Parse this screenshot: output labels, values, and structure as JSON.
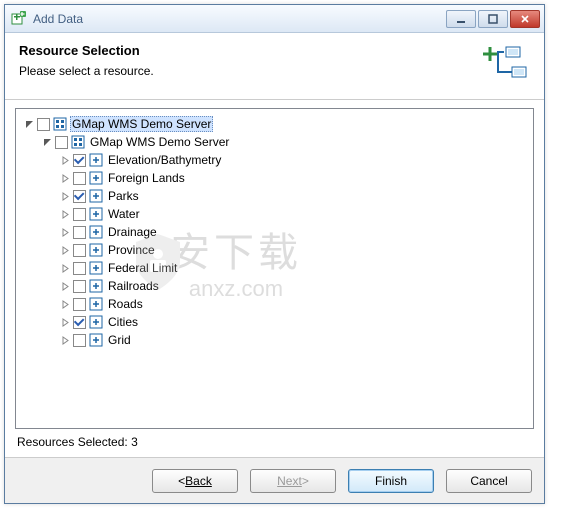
{
  "window": {
    "title": "Add Data"
  },
  "header": {
    "title": "Resource Selection",
    "subtitle": "Please select a resource."
  },
  "tree": {
    "root": {
      "label": "GMap WMS Demo Server",
      "expanded": true,
      "checked": false,
      "selected": true,
      "children": {
        "server": {
          "label": "GMap WMS Demo Server",
          "expanded": true,
          "checked": false,
          "layers": [
            {
              "label": "Elevation/Bathymetry",
              "checked": true
            },
            {
              "label": "Foreign Lands",
              "checked": false
            },
            {
              "label": "Parks",
              "checked": true
            },
            {
              "label": "Water",
              "checked": false
            },
            {
              "label": "Drainage",
              "checked": false
            },
            {
              "label": "Province",
              "checked": false
            },
            {
              "label": "Federal Limit",
              "checked": false
            },
            {
              "label": "Railroads",
              "checked": false
            },
            {
              "label": "Roads",
              "checked": false
            },
            {
              "label": "Cities",
              "checked": true
            },
            {
              "label": "Grid",
              "checked": false
            }
          ]
        }
      }
    }
  },
  "status": {
    "label": "Resources Selected: ",
    "count": "3"
  },
  "buttons": {
    "back": "Back",
    "next": "Next",
    "finish": "Finish",
    "cancel": "Cancel"
  },
  "watermark": {
    "cn": "安下载",
    "en": "anxz.com"
  }
}
